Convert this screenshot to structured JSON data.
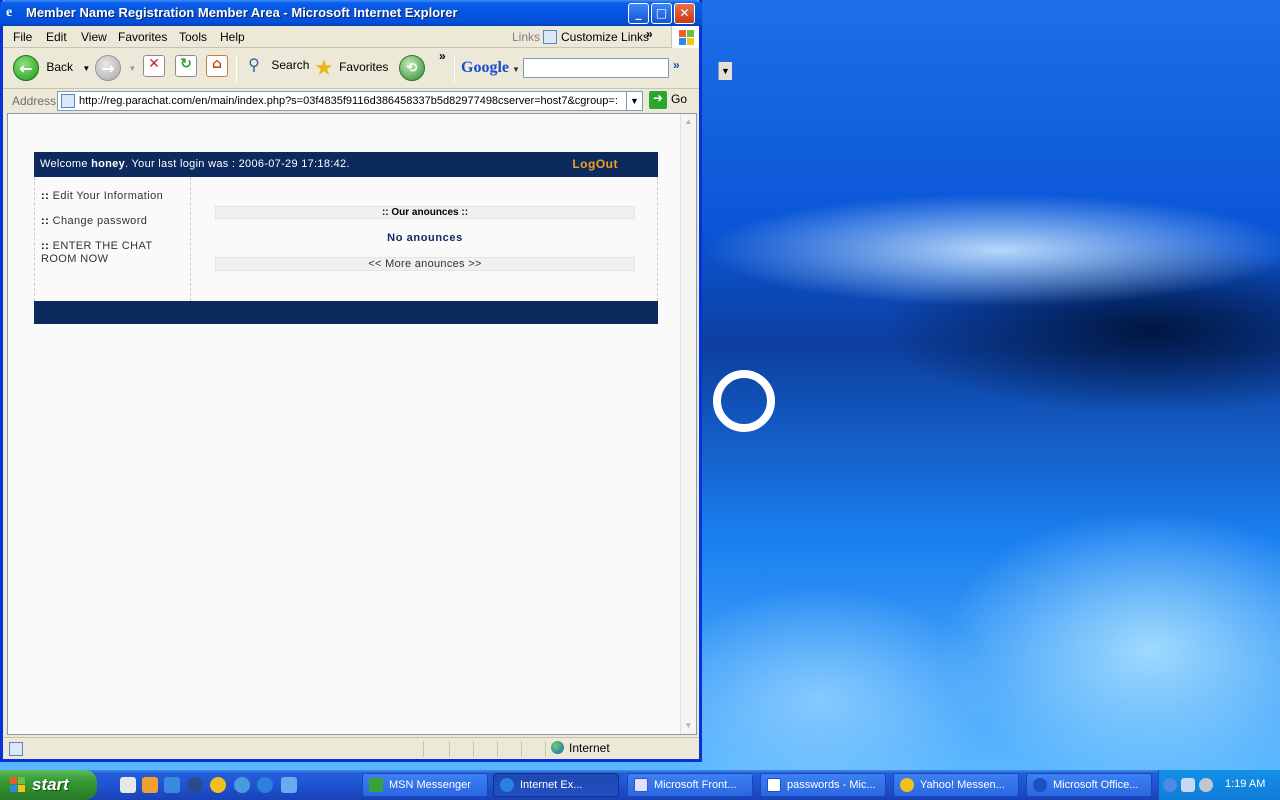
{
  "window": {
    "title": "Member Name Registration Member Area - Microsoft Internet Explorer",
    "minimize": "_",
    "maximize": "□",
    "close": "✕"
  },
  "menu": [
    "File",
    "Edit",
    "View",
    "Favorites",
    "Tools",
    "Help"
  ],
  "links": {
    "label": "Links",
    "customize": "Customize Links",
    "chevron": "»"
  },
  "toolbar": {
    "back": "Back",
    "search": "Search",
    "favorites": "Favorites",
    "more": "»",
    "google": "Google",
    "google_chevron": "»"
  },
  "address": {
    "label": "Address",
    "url": "http://reg.parachat.com/en/main/index.php?s=03f4835f9116d386458337b5d82977498cserver=host7&cgroup=:",
    "go": "Go"
  },
  "page": {
    "welcome_prefix": "Welcome ",
    "username": "honey",
    "welcome_suffix": ". Your last login was : 2006-07-29 17:18:42.",
    "logout": "LogOut",
    "side_links": [
      {
        "dots": "::",
        "label": "Edit Your Information"
      },
      {
        "dots": "::",
        "label": "Change password"
      },
      {
        "dots": "::",
        "label": "ENTER THE CHAT ROOM NOW"
      }
    ],
    "announces_header": ":: Our anounces ::",
    "no_announces": "No anounces",
    "more_announces": "<< More anounces >>"
  },
  "status": {
    "zone": "Internet"
  },
  "taskbar": {
    "start": "start",
    "tasks": [
      {
        "label": "MSN Messenger",
        "icon_color": "#3aa03a"
      },
      {
        "label": "Internet Ex...",
        "icon_color": "#2a7fe0",
        "active": true
      },
      {
        "label": "Microsoft Front...",
        "icon_color": "#e0e0ff"
      },
      {
        "label": "passwords - Mic...",
        "icon_color": "#ffffff"
      },
      {
        "label": "Yahoo! Messen...",
        "icon_color": "#f0c020"
      },
      {
        "label": "Microsoft Office...",
        "icon_color": "#2050c0"
      }
    ],
    "clock": "1:19 AM"
  }
}
